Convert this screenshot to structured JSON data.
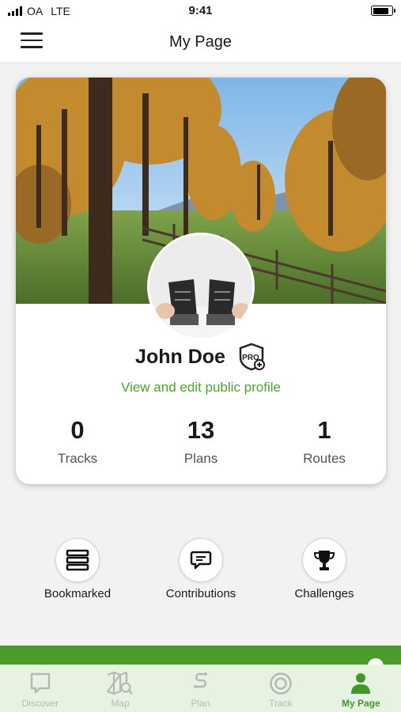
{
  "status": {
    "carrier": "OA",
    "network": "LTE",
    "time": "9:41"
  },
  "header": {
    "title": "My Page"
  },
  "profile": {
    "name": "John Doe",
    "link": "View and edit public profile",
    "stats": [
      {
        "value": "0",
        "label": "Tracks"
      },
      {
        "value": "13",
        "label": "Plans"
      },
      {
        "value": "1",
        "label": "Routes"
      }
    ]
  },
  "shortcuts": [
    {
      "label": "Bookmarked",
      "icon": "bookmark-list-icon"
    },
    {
      "label": "Contributions",
      "icon": "comment-icon"
    },
    {
      "label": "Challenges",
      "icon": "trophy-icon"
    }
  ],
  "tabs": [
    {
      "label": "Discover",
      "icon": "discover-icon"
    },
    {
      "label": "Map",
      "icon": "map-search-icon"
    },
    {
      "label": "Plan",
      "icon": "plan-route-icon"
    },
    {
      "label": "Track",
      "icon": "track-icon"
    },
    {
      "label": "My Page",
      "icon": "person-icon"
    }
  ],
  "colors": {
    "accent": "#4aa52e",
    "tab_bar_bg": "#e7f3e1",
    "green_bar": "#4b9b2c"
  }
}
